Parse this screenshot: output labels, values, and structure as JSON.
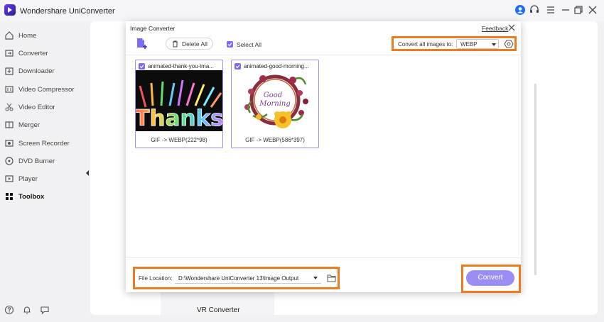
{
  "app": {
    "title": "Wondershare UniConverter"
  },
  "sidebar": {
    "items": [
      {
        "label": "Home",
        "icon": "home-icon"
      },
      {
        "label": "Converter",
        "icon": "converter-icon"
      },
      {
        "label": "Downloader",
        "icon": "downloader-icon"
      },
      {
        "label": "Video Compressor",
        "icon": "compress-icon"
      },
      {
        "label": "Video Editor",
        "icon": "scissors-icon"
      },
      {
        "label": "Merger",
        "icon": "merge-icon"
      },
      {
        "label": "Screen Recorder",
        "icon": "record-icon"
      },
      {
        "label": "DVD Burner",
        "icon": "disc-icon"
      },
      {
        "label": "Player",
        "icon": "play-icon"
      },
      {
        "label": "Toolbox",
        "icon": "grid-icon",
        "active": true
      }
    ]
  },
  "background": {
    "vr_label": "VR Converter"
  },
  "dialog": {
    "title": "Image Converter",
    "feedback": "Feedback",
    "delete_all": "Delete All",
    "select_all": "Select All",
    "convert_all_label": "Convert all images to:",
    "format": "WEBP",
    "files": [
      {
        "name": "animated-thank-you-ima...",
        "info": "GIF -> WEBP(222*98)",
        "checked": true
      },
      {
        "name": "animated-good-morning...",
        "info": "GIF -> WEBP(586*397)",
        "checked": true
      }
    ],
    "thumb_texts": {
      "thanks": "Thanks",
      "good": "Good",
      "morning": "Morning"
    },
    "file_location_label": "File Location:",
    "file_location": "D:\\Wondershare UniConverter 13\\Image Output",
    "convert": "Convert"
  },
  "colors": {
    "accent": "#7b6cf6",
    "highlight": "#ef7b20",
    "convert_button": "#9a8ef5"
  }
}
